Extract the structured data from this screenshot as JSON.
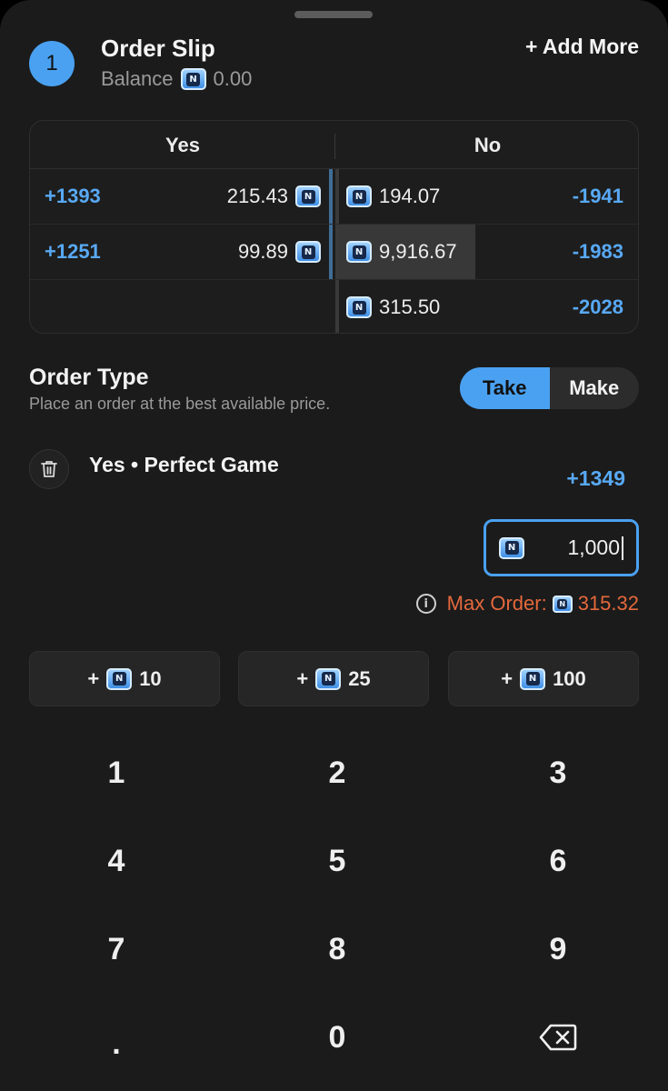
{
  "header": {
    "step": "1",
    "title": "Order Slip",
    "balance_label": "Balance",
    "balance_value": "0.00",
    "add_more": "+ Add More"
  },
  "order_book": {
    "yes_header": "Yes",
    "no_header": "No",
    "rows": [
      {
        "yes_odds": "+1393",
        "yes_amount": "215.43",
        "no_amount": "194.07",
        "no_odds": "-1941"
      },
      {
        "yes_odds": "+1251",
        "yes_amount": "99.89",
        "no_amount": "9,916.67",
        "no_odds": "-1983"
      },
      {
        "yes_odds": "",
        "yes_amount": "",
        "no_amount": "315.50",
        "no_odds": "-2028"
      }
    ]
  },
  "order_type": {
    "title": "Order Type",
    "subtitle": "Place an order at the best available price.",
    "options": [
      "Take",
      "Make"
    ],
    "selected": "Take"
  },
  "selection": {
    "label": "Yes • Perfect Game",
    "odds": "+1349",
    "amount": "1,000",
    "max_order_label": "Max Order:",
    "max_order_value": "315.32"
  },
  "quick_adds": [
    {
      "prefix": "+",
      "value": "10"
    },
    {
      "prefix": "+",
      "value": "25"
    },
    {
      "prefix": "+",
      "value": "100"
    }
  ],
  "keypad": [
    "1",
    "2",
    "3",
    "4",
    "5",
    "6",
    "7",
    "8",
    "9",
    ".",
    "0",
    "backspace-icon"
  ],
  "colors": {
    "accent": "#4aa1f1",
    "odds": "#58a9f4",
    "warning": "#e4683c",
    "background": "#1b1b1b"
  }
}
